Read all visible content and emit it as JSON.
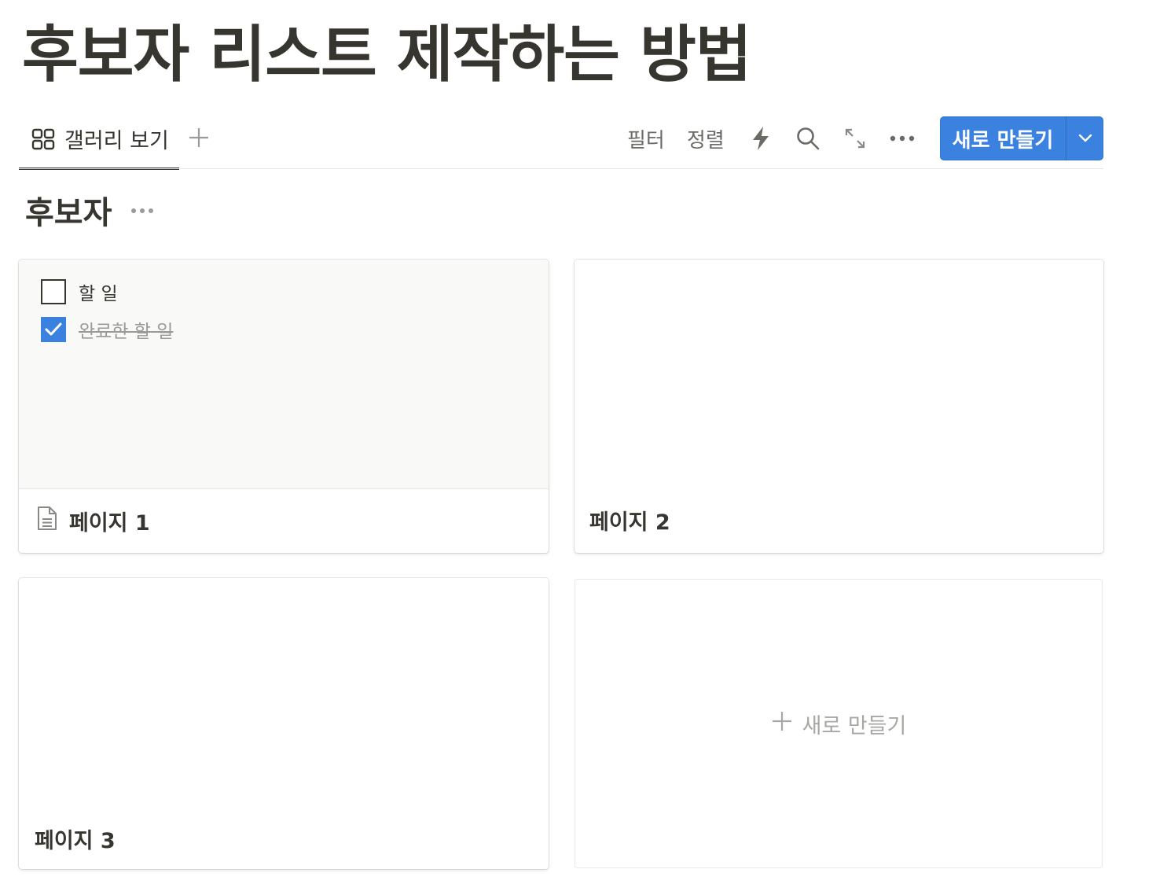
{
  "page": {
    "title": "후보자 리스트 제작하는 방법"
  },
  "toolbar": {
    "view_tab_label": "갤러리 보기",
    "filter_label": "필터",
    "sort_label": "정렬",
    "new_button_label": "새로 만들기",
    "accent_color": "#3b82e0"
  },
  "group": {
    "title": "후보자"
  },
  "cards": [
    {
      "title": "페이지 1",
      "icon": "page-icon",
      "todos": [
        {
          "label": "할 일",
          "checked": false
        },
        {
          "label": "완료한 할 일",
          "checked": true
        }
      ]
    },
    {
      "title": "페이지 2"
    },
    {
      "title": "페이지 3"
    }
  ],
  "new_card_label": "새로 만들기"
}
